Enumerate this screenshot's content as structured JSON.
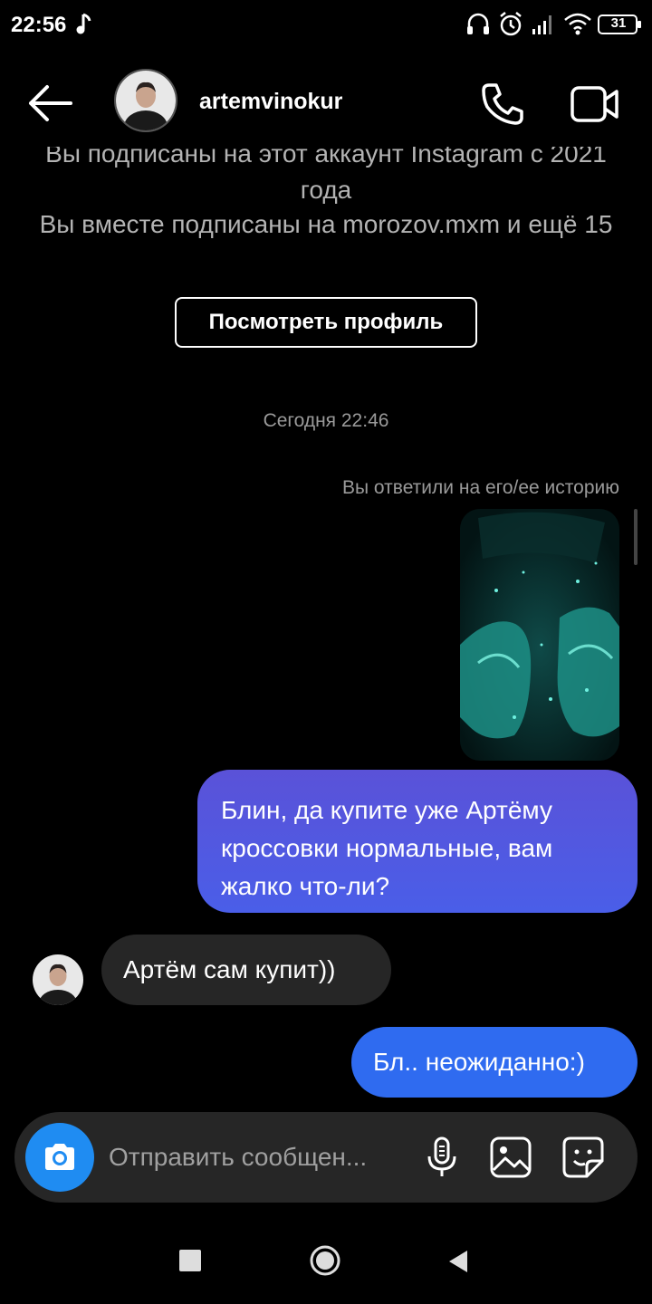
{
  "status_bar": {
    "time": "22:56",
    "battery": "31"
  },
  "header": {
    "username": "artemvinokur"
  },
  "chat": {
    "follow_since": "Вы подписаны на этот аккаунт Instagram с 2021 года",
    "mutual_followers": "Вы вместе подписаны на morozov.mxm и ещё 15",
    "view_profile_label": "Посмотреть профиль",
    "timestamp": "Сегодня 22:46",
    "story_reply_label": "Вы ответили на его/ее историю",
    "messages": [
      {
        "from": "me",
        "text": "Блин, да купите уже Артёму кроссовки нормальные, вам жалко что-ли?"
      },
      {
        "from": "them",
        "text": "Артём сам купит))"
      },
      {
        "from": "me",
        "text": "Бл.. неожиданно:)"
      }
    ]
  },
  "composer": {
    "placeholder": "Отправить сообщен..."
  },
  "colors": {
    "background": "#000000",
    "sent_bubble_gradient_start": "#5a52d8",
    "sent_bubble_end": "#2f6bf0",
    "received_bubble": "#262626",
    "camera_button": "#1f8cf2"
  },
  "icons": [
    "back-arrow-icon",
    "phone-icon",
    "video-camera-icon",
    "camera-icon",
    "microphone-icon",
    "gallery-icon",
    "sticker-icon",
    "nav-recents-icon",
    "nav-home-icon",
    "nav-back-icon"
  ]
}
